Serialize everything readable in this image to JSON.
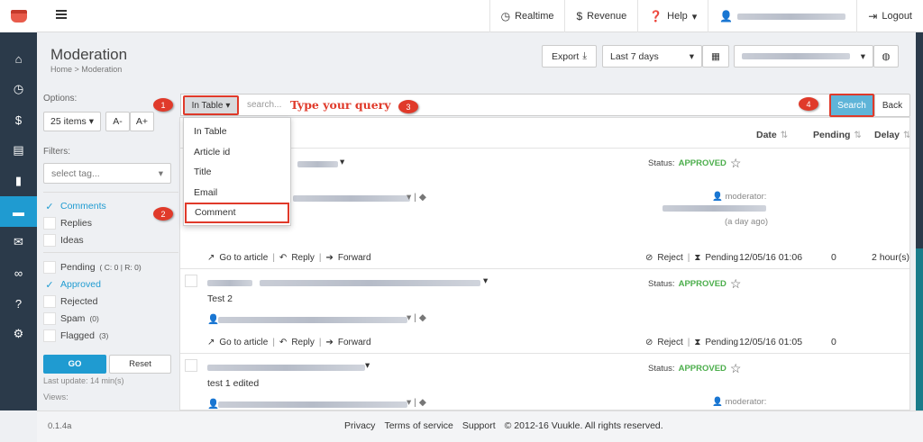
{
  "topnav": {
    "realtime": "Realtime",
    "revenue": "Revenue",
    "help": "Help",
    "logout": "Logout"
  },
  "page": {
    "title": "Moderation",
    "breadcrumb": "Home > Moderation"
  },
  "toolbar": {
    "export": "Export",
    "date_range": "Last 7 days"
  },
  "options": {
    "label": "Options:",
    "items_per_page": "25 items",
    "font_smaller": "A-",
    "font_larger": "A+",
    "filters_label": "Filters:",
    "tag_placeholder": "select tag...",
    "types": [
      {
        "label": "Comments",
        "checked": true
      },
      {
        "label": "Replies",
        "checked": false
      },
      {
        "label": "Ideas",
        "checked": false
      }
    ],
    "statuses": [
      {
        "label": "Pending",
        "count": "( C: 0 | R: 0)",
        "checked": false
      },
      {
        "label": "Approved",
        "count": "",
        "checked": true
      },
      {
        "label": "Rejected",
        "count": "",
        "checked": false
      },
      {
        "label": "Spam",
        "count": "(0)",
        "checked": false
      },
      {
        "label": "Flagged",
        "count": "(3)",
        "checked": false
      }
    ],
    "go": "GO",
    "reset": "Reset",
    "last_update": "Last update: 14 min(s)",
    "views_label": "Views:"
  },
  "search": {
    "scope": "In Table",
    "placeholder": "search...",
    "annotation": "Type your query",
    "submit": "Search",
    "back": "Back"
  },
  "scope_menu": [
    "In Table",
    "Article id",
    "Title",
    "Email",
    "Comment"
  ],
  "callouts": [
    "1",
    "2",
    "3",
    "4"
  ],
  "columns": {
    "date": "Date",
    "pending": "Pending",
    "delay": "Delay"
  },
  "rows": [
    {
      "status_label": "Status:",
      "status_value": "APPROVED",
      "text": "",
      "moderator_label": "moderator:",
      "moderated_ago": "(a day ago)",
      "go_to_article": "Go to article",
      "reply": "Reply",
      "forward": "Forward",
      "reject": "Reject",
      "pending": "Pending",
      "date": "12/05/16 01:06",
      "pending_count": "0",
      "delay": "2 hour(s)"
    },
    {
      "status_label": "Status:",
      "status_value": "APPROVED",
      "text": "Test 2",
      "go_to_article": "Go to article",
      "reply": "Reply",
      "forward": "Forward",
      "reject": "Reject",
      "pending": "Pending",
      "date": "12/05/16 01:05",
      "pending_count": "0",
      "delay": ""
    },
    {
      "status_label": "Status:",
      "status_value": "APPROVED",
      "text": "test 1 edited",
      "moderator_label": "moderator:"
    }
  ],
  "footer": {
    "version": "0.1.4a",
    "privacy": "Privacy",
    "terms": "Terms of service",
    "support": "Support",
    "copyright": "© 2012-16 Vuukle. All rights reserved."
  },
  "colors": {
    "sidebar": "#2b3a4a",
    "accent": "#1f9bd1",
    "annotation_red": "#e03a2a",
    "approved": "#4cae4c"
  }
}
